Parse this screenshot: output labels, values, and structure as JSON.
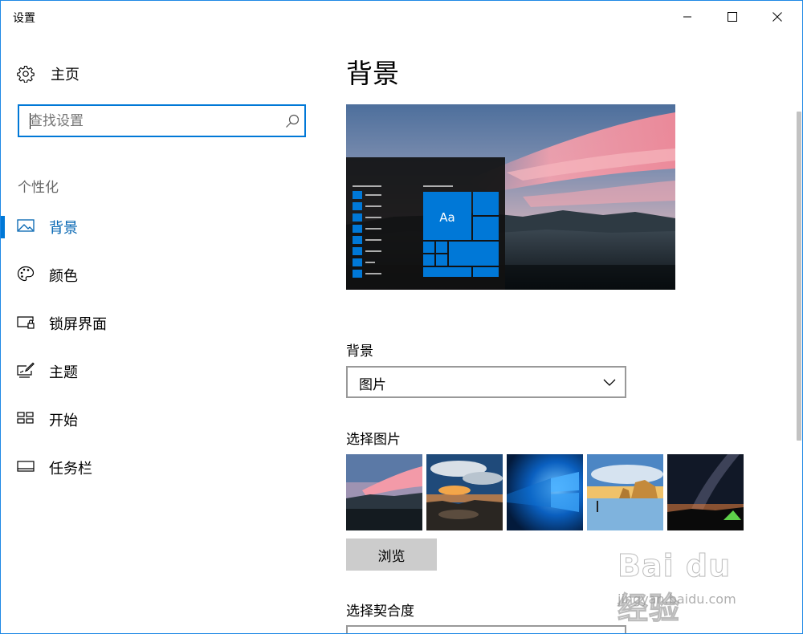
{
  "window": {
    "title": "设置"
  },
  "sidebar": {
    "home_label": "主页",
    "search_placeholder": "查找设置",
    "section_title": "个性化",
    "items": [
      {
        "label": "背景",
        "icon": "picture-icon",
        "active": true
      },
      {
        "label": "颜色",
        "icon": "palette-icon",
        "active": false
      },
      {
        "label": "锁屏界面",
        "icon": "lock-screen-icon",
        "active": false
      },
      {
        "label": "主题",
        "icon": "theme-brush-icon",
        "active": false
      },
      {
        "label": "开始",
        "icon": "start-tiles-icon",
        "active": false
      },
      {
        "label": "任务栏",
        "icon": "taskbar-icon",
        "active": false
      }
    ]
  },
  "main": {
    "title": "背景",
    "preview": {
      "sample_text": "Aa"
    },
    "background_label": "背景",
    "background_value": "图片",
    "choose_picture_label": "选择图片",
    "browse_label": "浏览",
    "fit_label": "选择契合度"
  },
  "watermark": {
    "text": "Bai du 经验",
    "sub": "jingyan.baidu.com"
  },
  "colors": {
    "accent": "#0078d7",
    "accent_text": "#0063b1",
    "window_border": "#1e88e5"
  }
}
